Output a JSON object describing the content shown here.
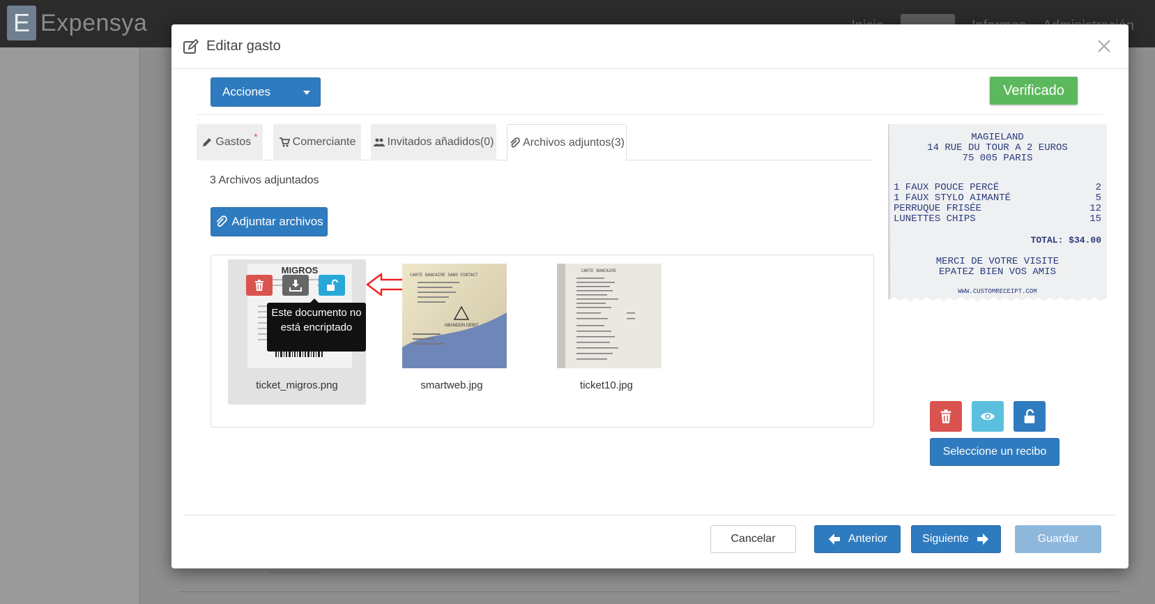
{
  "app": {
    "brand_letter": "E",
    "brand_name": "Expensya",
    "nav": [
      {
        "label": "Inicio"
      },
      {
        "label": ""
      },
      {
        "label": "Informes"
      },
      {
        "label": "Administración"
      }
    ]
  },
  "modal": {
    "title": "Editar gasto",
    "actions_label": "Acciones",
    "status_label": "Verificado",
    "tabs": [
      {
        "label": "Gastos",
        "required": "*"
      },
      {
        "label": "Comerciante"
      },
      {
        "label": "Invitados añadidos(0)"
      },
      {
        "label": "Archivos adjuntos(3)"
      }
    ],
    "attachments": {
      "count_text": "3 Archivos adjuntados",
      "attach_button": "Adjuntar archivos",
      "tooltip": "Este documento no está encriptado",
      "files": [
        {
          "name": "ticket_migros.png",
          "thumb_header": "MIGROS"
        },
        {
          "name": "smartweb.jpg",
          "thumb_header": "CARTE BANCAIRE SANS CONTACT",
          "thumb_note": "ABANDON DEBIT"
        },
        {
          "name": "ticket10.jpg",
          "thumb_header": "CARTE BANCAIRE"
        }
      ]
    },
    "receipt": {
      "lines": [
        "MAGIELAND",
        "14 RUE DU TOUR A 2 EUROS",
        "75 005 PARIS"
      ],
      "items": [
        {
          "name": "1 FAUX POUCE PERCÉ",
          "price": "2"
        },
        {
          "name": "1 FAUX STYLO AIMANTÉ",
          "price": "5"
        },
        {
          "name": "PERRUQUE FRISÉE",
          "price": "12"
        },
        {
          "name": "LUNETTES CHIPS",
          "price": "15"
        }
      ],
      "total": "TOTAL: $34.00",
      "footer1": "MERCI DE VOTRE VISITE",
      "footer2": "EPATEZ BIEN VOS AMIS",
      "website": "WWW.CUSTOMRECEIPT.COM"
    },
    "select_receipt_label": "Seleccione un recibo",
    "footer": {
      "cancel": "Cancelar",
      "previous": "Anterior",
      "next": "Siguiente",
      "save": "Guardar"
    }
  },
  "colors": {
    "primary": "#2f7bbf",
    "success": "#5cb85c",
    "danger": "#d9534f",
    "info": "#5bc0de",
    "muted": "#666666"
  }
}
